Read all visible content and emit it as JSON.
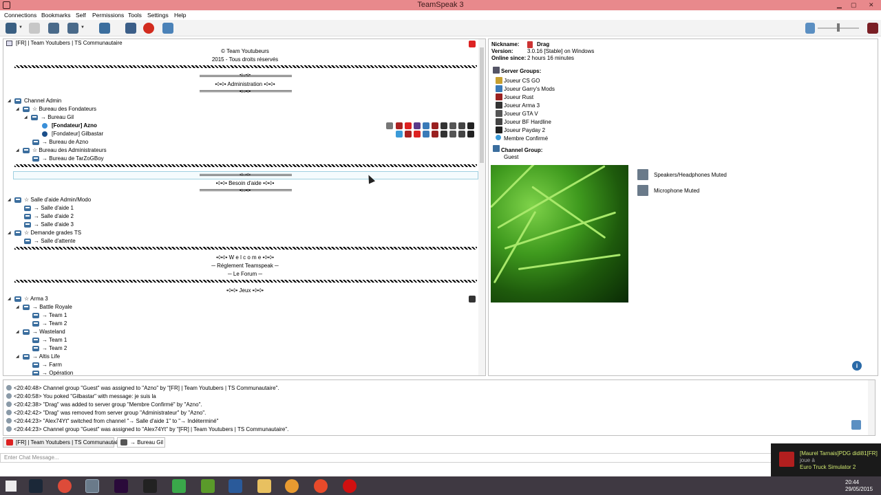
{
  "window": {
    "title": "TeamSpeak 3"
  },
  "menu": [
    "Connections",
    "Bookmarks",
    "Self",
    "Permissions",
    "Tools",
    "Settings",
    "Help"
  ],
  "toolbar": {
    "icons": [
      "connect-icon",
      "disconnect-icon",
      "mute-microphone-icon",
      "mute-speakers-icon",
      "away-icon",
      "contacts-icon",
      "bookmark-icon",
      "add-bookmark-icon",
      "volume-icon"
    ]
  },
  "server_tree": {
    "server_name": "[FR] | Team Youtubers | TS Communautaire",
    "header_lines": [
      "© Team Youtubeurs",
      "2015 - Tous droits réservés"
    ],
    "admin_banner_top": "•◊○•◊•",
    "admin_banner_label": "•◊•◊•  Administration  •◊•◊•",
    "channels": [
      {
        "label": "Channel Admin"
      },
      {
        "label": "☆ Bureau des Fondateurs"
      },
      {
        "label": "→ Bureau Gil"
      },
      {
        "label": "[Fondateur] Azno"
      },
      {
        "label": "[Fondateur] Gilbastar"
      },
      {
        "label": "→ Bureau de Azno"
      },
      {
        "label": "☆ Bureau des Administrateurs"
      },
      {
        "label": "→ Bureau de TarZoGBoy"
      },
      {
        "label": "☆ Salle d'aide Admin/Modo"
      },
      {
        "label": "→ Salle d'aide 1"
      },
      {
        "label": "→ Salle d'aide 2"
      },
      {
        "label": "→ Salle d'aide 3"
      },
      {
        "label": "☆ Demande grades TS"
      },
      {
        "label": "→ Salle d'attente"
      },
      {
        "label": "☆ Arma 3"
      },
      {
        "label": "→ Battle Royale"
      },
      {
        "label": "→ Team 1"
      },
      {
        "label": "→ Team 2"
      },
      {
        "label": "→ Wasteland"
      },
      {
        "label": "→ Team 1"
      },
      {
        "label": "→ Team 2"
      },
      {
        "label": "→ Altis Life"
      },
      {
        "label": "→ Farm"
      },
      {
        "label": "→ Opération"
      }
    ],
    "help_banner_label": "•◊•◊•  Besoin d'aide  •◊•◊•",
    "welcome_lines": [
      "•◊•◊• W e l c o m e •◊•◊•",
      "─ Réglement Teamspeak ─",
      "─ Le Forum ─"
    ],
    "games_label": "•◊•◊•  Jeux  •◊•◊•"
  },
  "client_info": {
    "nickname_label": "Nickname:",
    "nickname": "Drag",
    "version_label": "Version:",
    "version": "3.0.16 [Stable] on Windows",
    "online_label": "Online since:",
    "online": "2 hours 16 minutes",
    "server_groups_label": "Server Groups:",
    "server_groups": [
      "Joueur CS GO",
      "Joueur Garry's Mods",
      "Joueur Rust",
      "Joueur Arma 3",
      "Joueur GTA V",
      "Joueur BF Hardline",
      "Joueur Payday 2",
      "Membre Confirmé"
    ],
    "channel_group_label": "Channel Group:",
    "channel_group": "Guest",
    "status": [
      "Speakers/Headphones Muted",
      "Microphone Muted"
    ]
  },
  "log": [
    {
      "time": "<20:40:48>",
      "text": "Channel group \"Guest\" was assigned to \"Azno\" by \"[FR] | Team Youtubers | TS Communautaire\"."
    },
    {
      "time": "<20:40:58>",
      "text": "You poked \"Gilbastar\" with message: je suis la"
    },
    {
      "time": "<20:42:38>",
      "text": "\"Drag\" was added to server group \"Membre Confirmé\" by \"Azno\"."
    },
    {
      "time": "<20:42:42>",
      "text": "\"Drag\" was removed from server group \"Administrateur\" by \"Azno\"."
    },
    {
      "time": "<20:44:23>",
      "text": "\"Alex74Yt\" switched from channel \"→ Salle d'aide 1\" to \"→ Indéterminé\""
    },
    {
      "time": "<20:44:23>",
      "text": "Channel group \"Guest\" was assigned to \"Alex74Yt\" by \"[FR] | Team Youtubers | TS Communautaire\"."
    }
  ],
  "tabs": [
    "[FR] | Team Youtubers | TS Communautaire",
    "→ Bureau Gil"
  ],
  "chat": {
    "placeholder": "Enter Chat Message..."
  },
  "notification": {
    "line1": "[Maurel Tarnais]PDG didi81[FR]",
    "line2": "joue à",
    "line3": "Euro Truck Simulator 2"
  },
  "taskbar": {
    "time": "20:44",
    "date": "29/05/2015"
  },
  "colors": {
    "titlebar": "#e8898c",
    "taskbar": "#3f3942",
    "channel_icon": "#3b6e9e"
  }
}
